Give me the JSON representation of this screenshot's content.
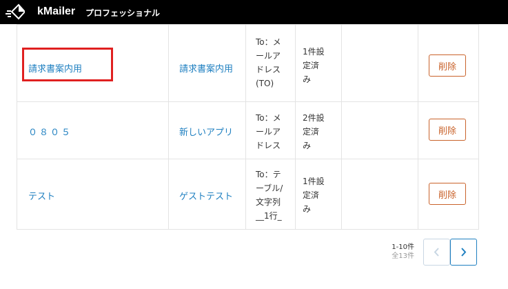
{
  "header": {
    "app_name": "kMailer",
    "plan": "プロフェッショナル"
  },
  "rows": [
    {
      "name": "請求書案内用",
      "app": "請求書案内用",
      "to": [
        "To：メ",
        "ールア",
        "ドレス",
        "(TO)"
      ],
      "status": [
        "1件設",
        "定済",
        "み"
      ],
      "delete": "削除"
    },
    {
      "name": "０８０５",
      "app": "新しいアプリ",
      "to": [
        "To：メ",
        "ールア",
        "ドレス"
      ],
      "status": [
        "2件設",
        "定済",
        "み"
      ],
      "delete": "削除"
    },
    {
      "name": "テスト",
      "app": "ゲストテスト",
      "to": [
        "To：テ",
        "ーブル/",
        "文字列",
        "__1行_"
      ],
      "status": [
        "1件設",
        "定済",
        "み"
      ],
      "delete": "削除"
    }
  ],
  "pagination": {
    "range": "1-10件",
    "total": "全13件"
  },
  "colors": {
    "link": "#1e7fc0",
    "delete": "#c9622a",
    "highlight": "#e02020"
  }
}
